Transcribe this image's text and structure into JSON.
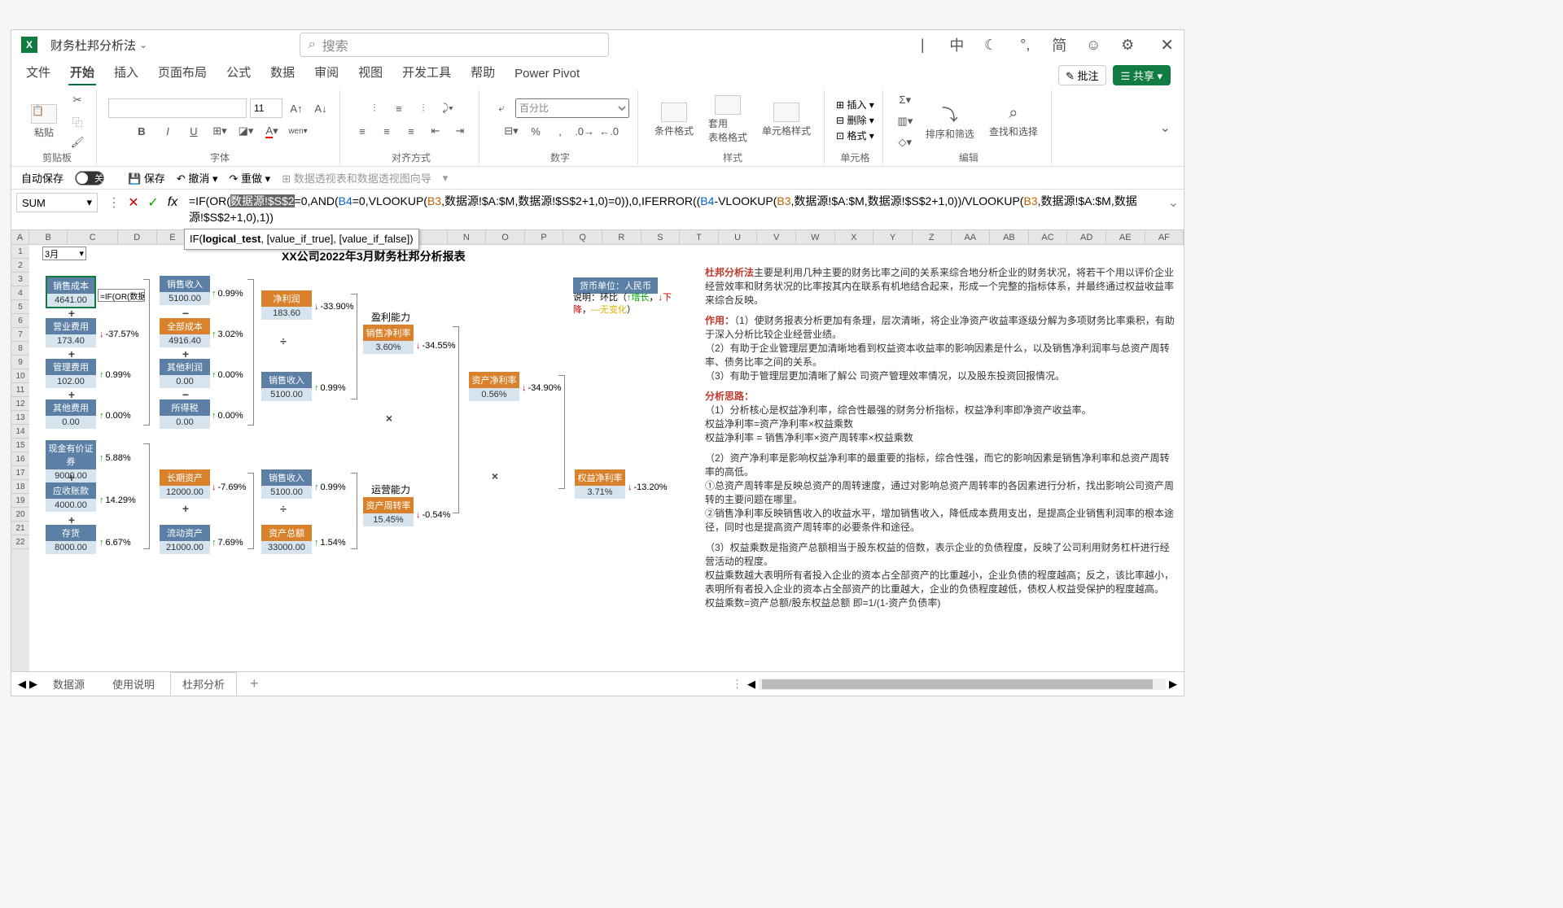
{
  "title": "财务杜邦分析法",
  "search_placeholder": "搜索",
  "titlebar_icons": {
    "ime1": "|",
    "ime2": "中",
    "moon": "☾",
    "comma": "°,",
    "simp": "简",
    "emoji": "☺",
    "gear": "⚙"
  },
  "tabs": {
    "file": "文件",
    "home": "开始",
    "insert": "插入",
    "layout": "页面布局",
    "formula": "公式",
    "data": "数据",
    "review": "审阅",
    "view": "视图",
    "dev": "开发工具",
    "help": "帮助",
    "pivot": "Power Pivot"
  },
  "tabs_right": {
    "annotate": "批注",
    "share": "共享"
  },
  "ribbon": {
    "clipboard": {
      "paste": "粘贴",
      "label": "剪贴板"
    },
    "font": {
      "size": "11",
      "label": "字体"
    },
    "align": {
      "label": "对齐方式"
    },
    "number": {
      "format": "百分比",
      "label": "数字"
    },
    "styles": {
      "cond": "条件格式",
      "table": "套用\n表格格式",
      "cell": "单元格样式",
      "label": "样式"
    },
    "cells": {
      "ins": "插入",
      "del": "删除",
      "fmt": "格式",
      "label": "单元格"
    },
    "edit": {
      "sort": "排序和筛选",
      "find": "查找和选择",
      "label": "编辑"
    }
  },
  "qat": {
    "autosave": "自动保存",
    "autosave_state": "关",
    "save": "保存",
    "undo": "撤消",
    "redo": "重做",
    "pivot": "数据透视表和数据透视图向导"
  },
  "namebox": "SUM",
  "formula": "=IF(OR(数据源!$S$2=0,AND(B4=0,VLOOKUP(B3,数据源!$A:$M,数据源!$S$2+1,0)=0)),0,IFERROR((B4-VLOOKUP(B3,数据源!$A:$M,数据源!$S$2+1,0))/VLOOKUP(B3,数据源!$A:$M,数据源!$S$2+1,0),1))",
  "formula_seg": {
    "p1": "=IF(OR(",
    "hl": "数据源!$S$2",
    "p2": "=0,AND(",
    "b4a": "B4",
    "p3": "=0,VLOOKUP(",
    "b3a": "B3",
    "p4": ",数据源!$A:$M,数据源!$S$2+1,0)=0)),0,IFERROR((",
    "b4b": "B4",
    "p5": "-VLOOKUP(",
    "b3b": "B3",
    "p6": ",数据源!$A:$M,数据源!$S$2+1,0))/VLOOKUP(",
    "b3c": "B3",
    "p7": ",数据源!$A:$M,数据源!$S$2+1,0),1))"
  },
  "fn_hint": {
    "pre": "IF(",
    "bold": "logical_test",
    "post": ", [value_if_true], [value_if_false])"
  },
  "cols": [
    "A",
    "B",
    "C",
    "D",
    "E",
    "",
    "",
    "",
    "",
    "",
    "",
    "",
    "",
    "N",
    "O",
    "P",
    "Q",
    "R",
    "S",
    "T",
    "U",
    "V",
    "W",
    "X",
    "Y",
    "Z",
    "AA",
    "AB",
    "AC",
    "AD",
    "AE",
    "AF"
  ],
  "rows": [
    "1",
    "2",
    "3",
    "4",
    "5",
    "6",
    "7",
    "8",
    "9",
    "10",
    "11",
    "12",
    "13",
    "14",
    "15",
    "16",
    "17",
    "18",
    "19",
    "20",
    "21",
    "22"
  ],
  "report_title": "XX公司2022年3月财务杜邦分析报表",
  "month": "3月",
  "currency": "货币单位：人民币",
  "legend": {
    "prefix": "说明：",
    "huanbi": "环比（",
    "up": "↑增长",
    "sep": "，",
    "down": "↓下降",
    "sep2": "，",
    "flat": "—无变化",
    "end": "）"
  },
  "cell_edit": "=IF(OR(数据",
  "boxes": {
    "xscb": {
      "name": "销售成本",
      "val": "4641.00"
    },
    "yyfy": {
      "name": "营业费用",
      "val": "173.40",
      "pct": "-37.57%"
    },
    "glfy": {
      "name": "管理费用",
      "val": "102.00",
      "pct": "0.99%"
    },
    "qtfy": {
      "name": "其他费用",
      "val": "0.00",
      "pct": "0.00%"
    },
    "xssr1": {
      "name": "销售收入",
      "val": "5100.00",
      "pct": "0.99%"
    },
    "qbcb": {
      "name": "全部成本",
      "val": "4916.40",
      "pct": "3.02%"
    },
    "qtlr": {
      "name": "其他利润",
      "val": "0.00",
      "pct": "0.00%"
    },
    "sds": {
      "name": "所得税",
      "val": "0.00",
      "pct": "0.00%"
    },
    "jlr": {
      "name": "净利润",
      "val": "183.60",
      "pct": "-33.90%"
    },
    "xssr2": {
      "name": "销售收入",
      "val": "5100.00",
      "pct": "0.99%"
    },
    "xsjll": {
      "name": "销售净利率",
      "val": "3.60%",
      "pct": "-34.55%"
    },
    "zcjll": {
      "name": "资产净利率",
      "val": "0.56%",
      "pct": "-34.90%"
    },
    "xjzq": {
      "name": "现金有价证券",
      "val": "9000.00",
      "pct": "5.88%"
    },
    "yszk": {
      "name": "应收账款",
      "val": "4000.00",
      "pct": "14.29%"
    },
    "ch": {
      "name": "存货",
      "val": "8000.00",
      "pct": "6.67%"
    },
    "cqzc": {
      "name": "长期资产",
      "val": "12000.00",
      "pct": "-7.69%"
    },
    "ldzc": {
      "name": "流动资产",
      "val": "21000.00",
      "pct": "7.69%"
    },
    "xssr3": {
      "name": "销售收入",
      "val": "5100.00",
      "pct": "0.99%"
    },
    "zcze": {
      "name": "资产总额",
      "val": "33000.00",
      "pct": "1.54%"
    },
    "zczzl": {
      "name": "资产周转率",
      "val": "15.45%",
      "pct": "-0.54%"
    },
    "qyjll": {
      "name": "权益净利率",
      "val": "3.71%",
      "pct": "-13.20%"
    },
    "ylnl": "盈利能力",
    "yynl": "运营能力"
  },
  "analysis": {
    "p1a": "杜邦分析法",
    "p1b": "主要是利用几种主要的财务比率之间的关系来综合地分析企业的财务状况，将若干个用以评价企业经营效率和财务状况的比率按其内在联系有机地结合起来，形成一个完整的指标体系，并最终通过权益收益率来综合反映。",
    "p2a": "作用：",
    "p2b": "（1）使财务报表分析更加有条理，层次清晰，将企业净资产收益率逐级分解为多项财务比率乘积，有助于深入分析比较企业经营业绩。",
    "p2c": "（2）有助于企业管理层更加清晰地看到权益资本收益率的影响因素是什么，以及销售净利润率与总资产周转率、债务比率之间的关系。",
    "p2d": "（3）有助于管理层更加清晰了解公 司资产管理效率情况，以及股东投资回报情况。",
    "p3a": "分析思路：",
    "p3b": "（1）分析核心是权益净利率，综合性最强的财务分析指标，权益净利率即净资产收益率。",
    "p3c": "权益净利率=资产净利率×权益乘数",
    "p3d": "权益净利率 = 销售净利率×资产周转率×权益乘数",
    "p3e": "（2）资产净利率是影响权益净利率的最重要的指标，综合性强，而它的影响因素是销售净利率和总资产周转率的高低。",
    "p3f": "①总资产周转率是反映总资产的周转速度，通过对影响总资产周转率的各因素进行分析，找出影响公司资产周转的主要问题在哪里。",
    "p3g": "②销售净利率反映销售收入的收益水平，增加销售收入，降低成本费用支出，是提高企业销售利润率的根本途径，同时也是提高资产周转率的必要条件和途径。",
    "p3h": "（3）权益乘数是指资产总额相当于股东权益的倍数，表示企业的负债程度，反映了公司利用财务杠杆进行经营活动的程度。",
    "p3i": "权益乘数越大表明所有者投入企业的资本占全部资产的比重越小，企业负债的程度越高；反之，该比率越小，表明所有者投入企业的资本占全部资产的比重越大，企业的负债程度越低，债权人权益受保护的程度越高。",
    "p3j": "权益乘数=资产总额/股东权益总额 即=1/(1-资产负债率)"
  },
  "sheets": {
    "s1": "数据源",
    "s2": "使用说明",
    "s3": "杜邦分析"
  }
}
